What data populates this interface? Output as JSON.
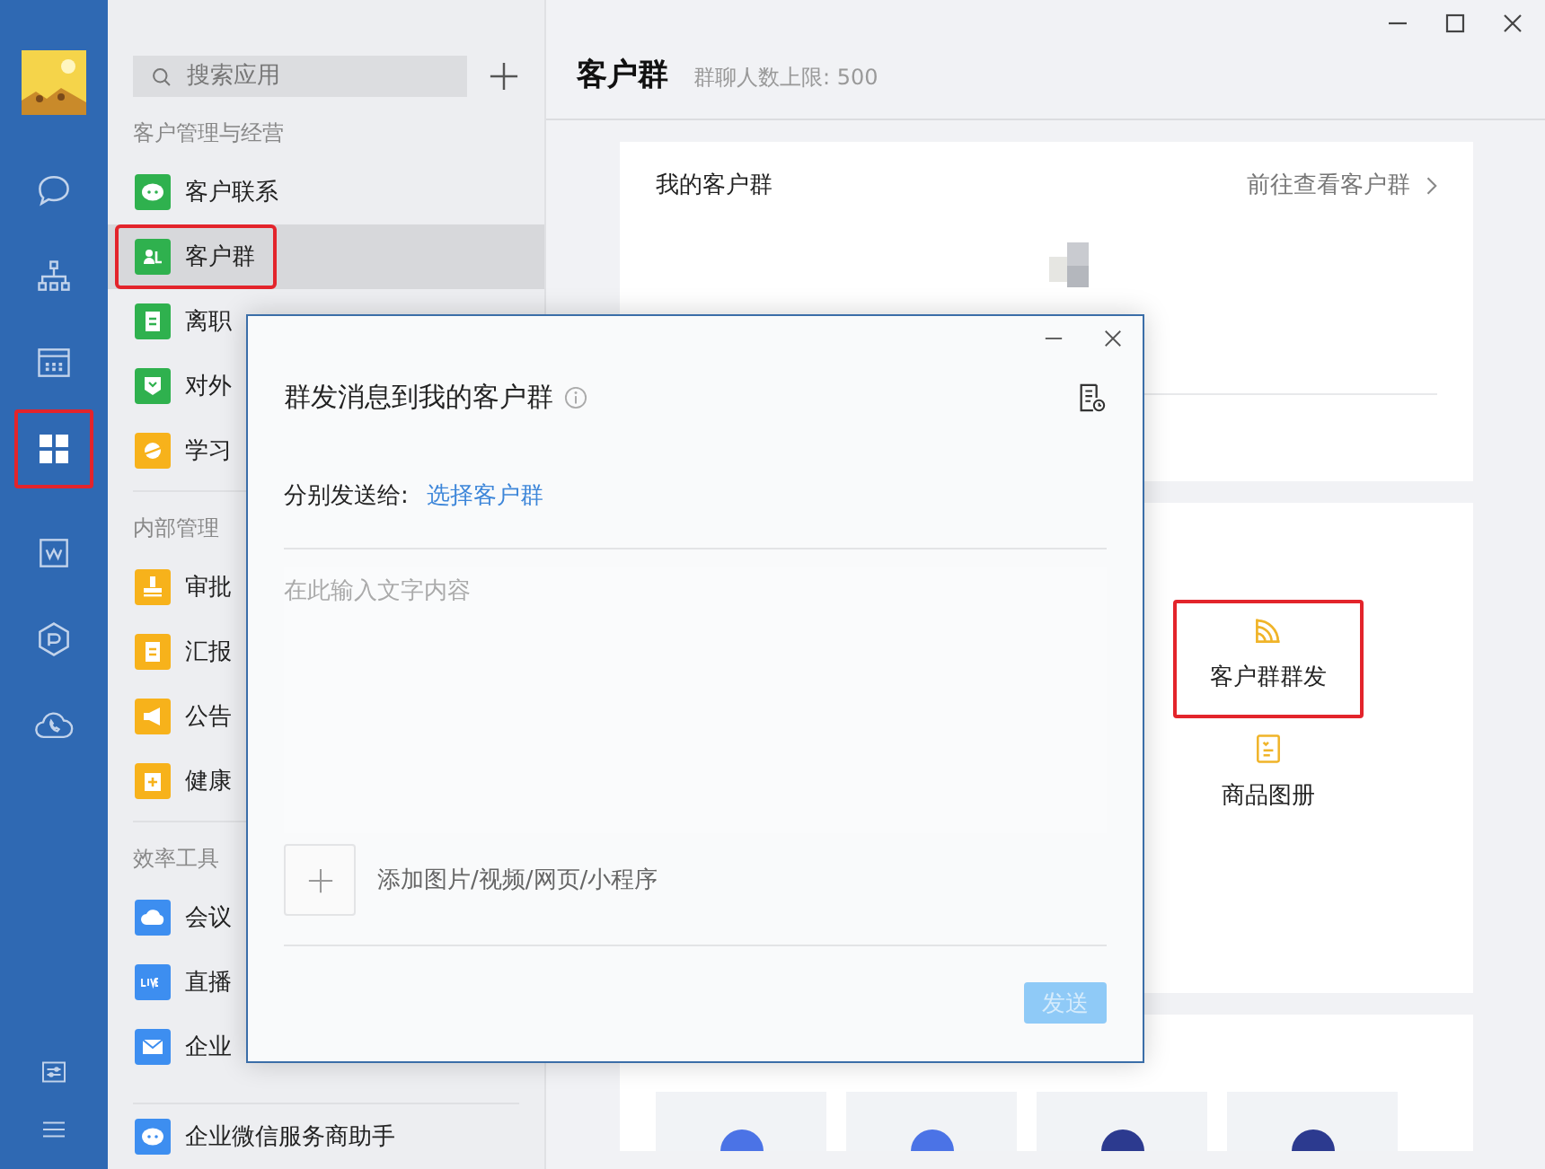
{
  "rail": {
    "items": [
      {
        "kind": "chat",
        "selected": false,
        "highlighted": false
      },
      {
        "kind": "org",
        "selected": false,
        "highlighted": false
      },
      {
        "kind": "calendar",
        "selected": false,
        "highlighted": false
      },
      {
        "kind": "apps",
        "selected": true,
        "highlighted": true
      },
      {
        "kind": "doc",
        "selected": false,
        "highlighted": false
      },
      {
        "kind": "hexagon",
        "selected": false,
        "highlighted": false
      },
      {
        "kind": "phone",
        "selected": false,
        "highlighted": false
      }
    ],
    "bottom": [
      {
        "kind": "settings"
      },
      {
        "kind": "menu"
      }
    ]
  },
  "sidebar": {
    "search": {
      "placeholder": "搜索应用"
    },
    "sections": [
      {
        "title": "客户管理与经营",
        "items": [
          {
            "label": "客户联系",
            "kind": "chat",
            "color": "#2fb14e",
            "selected": false,
            "highlighted": false
          },
          {
            "label": "客户群",
            "kind": "group",
            "color": "#2fb14e",
            "selected": true,
            "highlighted": true
          },
          {
            "label": "离职",
            "kind": "list",
            "color": "#2fb14e",
            "selected": false,
            "highlighted": false
          },
          {
            "label": "对外",
            "kind": "badge",
            "color": "#2fb14e",
            "selected": false,
            "highlighted": false
          },
          {
            "label": "学习",
            "kind": "planet",
            "color": "#f7b21b",
            "selected": false,
            "highlighted": false
          }
        ]
      },
      {
        "title": "内部管理",
        "items": [
          {
            "label": "审批",
            "kind": "stamp",
            "color": "#f7b21b",
            "selected": false,
            "highlighted": false
          },
          {
            "label": "汇报",
            "kind": "list",
            "color": "#f7b21b",
            "selected": false,
            "highlighted": false
          },
          {
            "label": "公告",
            "kind": "megaphone",
            "color": "#f7b21b",
            "selected": false,
            "highlighted": false
          },
          {
            "label": "健康",
            "kind": "kit",
            "color": "#f7b21b",
            "selected": false,
            "highlighted": false
          }
        ]
      },
      {
        "title": "效率工具",
        "items": [
          {
            "label": "会议",
            "kind": "cloud",
            "color": "#3d8ef0",
            "selected": false,
            "highlighted": false
          },
          {
            "label": "直播",
            "kind": "live",
            "color": "#3d8ef0",
            "selected": false,
            "highlighted": false
          },
          {
            "label": "企业",
            "kind": "mail",
            "color": "#3d8ef0",
            "selected": false,
            "highlighted": false
          }
        ]
      }
    ],
    "footer": {
      "label": "企业微信服务商助手",
      "kind": "bubble",
      "color": "#3d8ef0"
    }
  },
  "main": {
    "title": "客户群",
    "subtitle": "群聊人数上限: 500",
    "my_groups": {
      "title": "我的客户群",
      "link": "前往查看客户群"
    },
    "tools": [
      {
        "label": "客户群群发",
        "kind": "broadcast",
        "highlighted": true
      },
      {
        "label": "商品图册",
        "kind": "catalog",
        "highlighted": false
      }
    ],
    "app_tiles": [
      {
        "color": "#4b73e6"
      },
      {
        "color": "#4b73e6"
      },
      {
        "color": "#2c3a8f"
      },
      {
        "color": "#2c3a8f"
      }
    ]
  },
  "dialog": {
    "title": "群发消息到我的客户群",
    "recipients_label": "分别发送给:",
    "recipients_link": "选择客户群",
    "placeholder": "在此输入文字内容",
    "attach_label": "添加图片/视频/网页/小程序",
    "send": {
      "label": "发送",
      "disabled": true
    }
  }
}
